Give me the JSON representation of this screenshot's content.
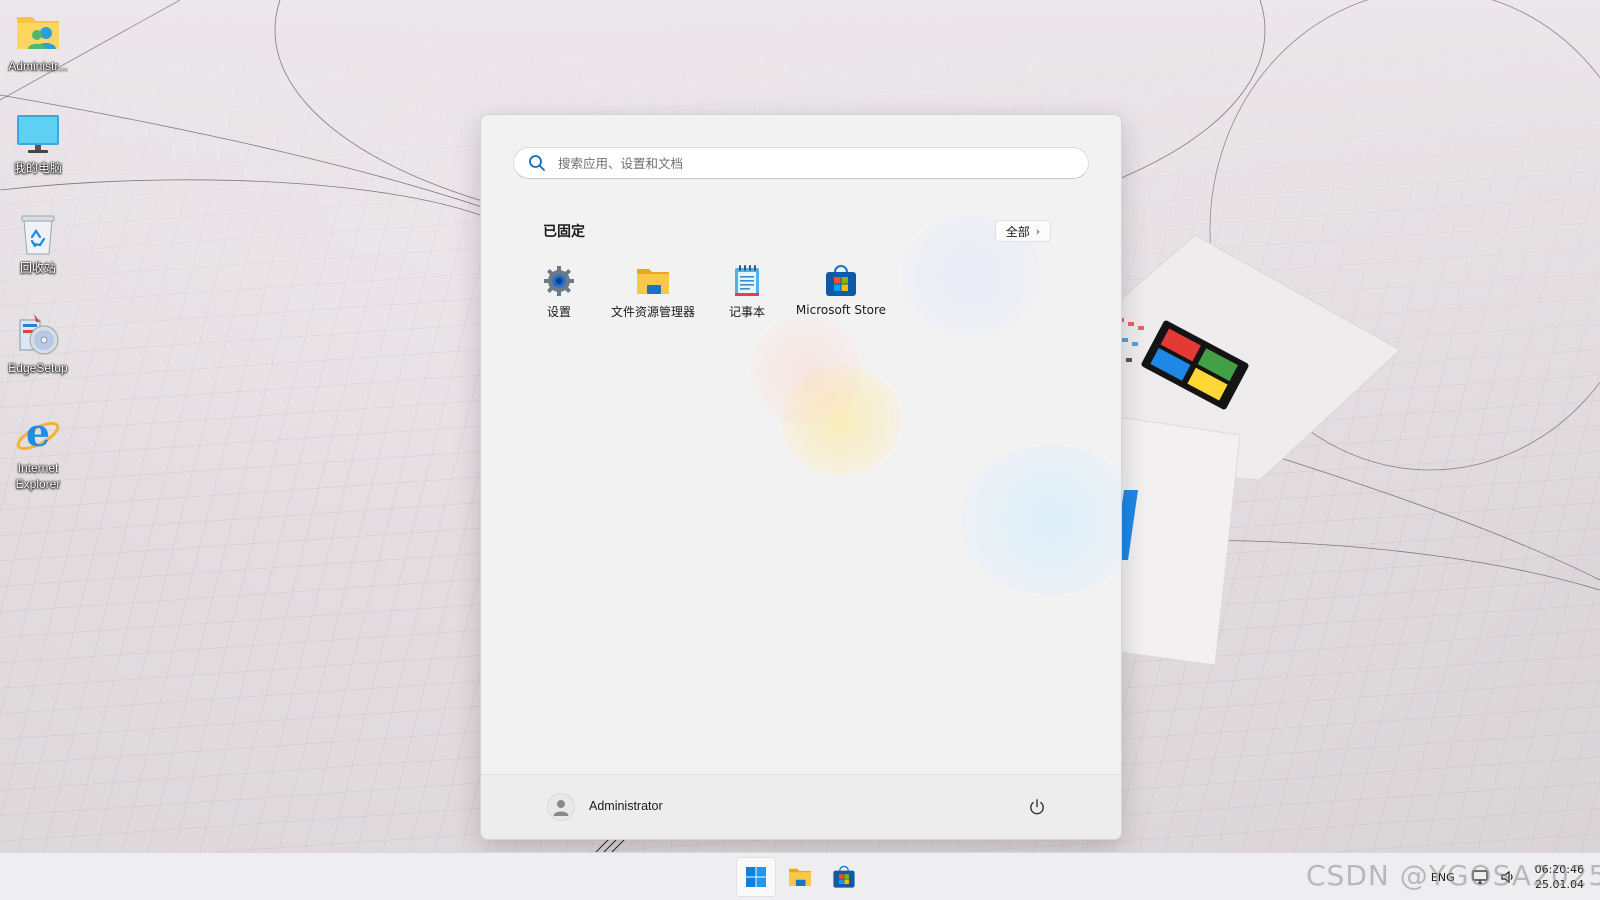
{
  "desktop": {
    "icons": [
      {
        "label": "Administr...",
        "icon": "user-folder-icon"
      },
      {
        "label": "我的电脑",
        "icon": "computer-monitor-icon"
      },
      {
        "label": "回收站",
        "icon": "recycle-bin-icon"
      },
      {
        "label": "EdgeSetup",
        "icon": "installer-disc-icon"
      },
      {
        "label": "Internet Explorer",
        "icon": "internet-explorer-icon"
      }
    ]
  },
  "start_menu": {
    "search": {
      "placeholder": "搜索应用、设置和文档",
      "value": "",
      "icon": "search-icon"
    },
    "pinned_title": "已固定",
    "all_button": {
      "label": "全部",
      "icon": "chevron-right-icon"
    },
    "pinned_apps": [
      {
        "label": "设置",
        "icon": "settings-gear-icon"
      },
      {
        "label": "文件资源管理器",
        "icon": "file-explorer-folder-icon"
      },
      {
        "label": "记事本",
        "icon": "notepad-icon"
      },
      {
        "label": "Microsoft Store",
        "icon": "microsoft-store-icon"
      }
    ],
    "user": {
      "name": "Administrator",
      "icon": "user-avatar-icon"
    },
    "power_icon": "power-icon"
  },
  "taskbar": {
    "apps": [
      {
        "name": "Start",
        "icon": "windows-start-icon"
      },
      {
        "name": "File Explorer",
        "icon": "file-explorer-folder-icon"
      },
      {
        "name": "Microsoft Store",
        "icon": "microsoft-store-icon"
      }
    ],
    "tray": {
      "language": "ENG",
      "network_icon": "network-icon",
      "volume_icon": "volume-icon",
      "time": "06:20:46",
      "date": "25.01.04"
    }
  },
  "watermark": "CSDN @YGOSA2025",
  "colors": {
    "accent_blue": "#0f6cbd",
    "folder_yellow": "#f7c948",
    "menu_background": "#f3f2f3"
  }
}
